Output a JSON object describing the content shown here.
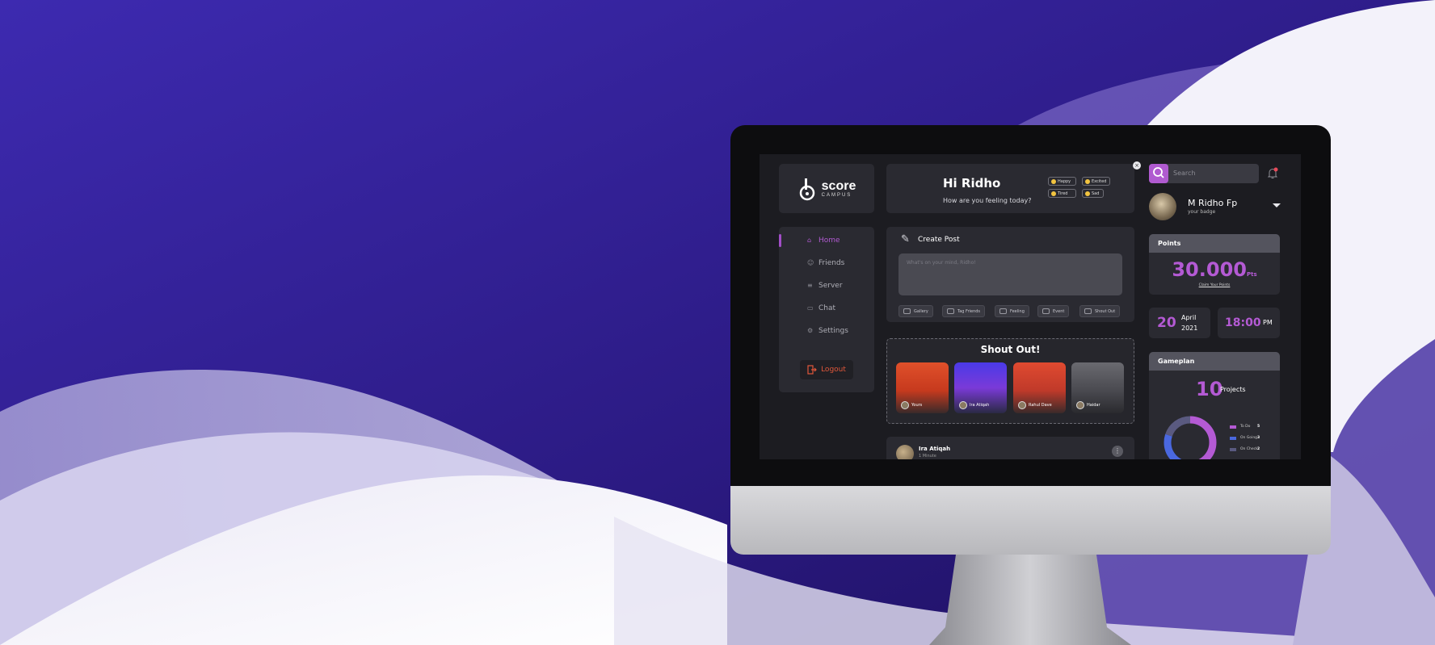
{
  "colors": {
    "background_top": "#2a1a7c",
    "accent": "#b45ad4",
    "logout": "#e0573a",
    "todo": "#b45ad4",
    "ongoing": "#4a68e0",
    "oncheck": "#5a5a80"
  },
  "logo": {
    "main": "score",
    "sub": "CAMPUS"
  },
  "nav": {
    "items": [
      {
        "label": "Home",
        "icon": "home-icon",
        "active": true
      },
      {
        "label": "Friends",
        "icon": "friends-icon",
        "active": false
      },
      {
        "label": "Server",
        "icon": "server-icon",
        "active": false
      },
      {
        "label": "Chat",
        "icon": "chat-icon",
        "active": false
      },
      {
        "label": "Settings",
        "icon": "settings-icon",
        "active": false
      }
    ],
    "logout": "Logout"
  },
  "greeting": {
    "title": "Hi  Ridho",
    "subtitle": "How are you feeling today?",
    "moods": [
      "Happy",
      "Excited",
      "Tired",
      "Sad"
    ]
  },
  "create_post": {
    "title": "Create Post",
    "placeholder": "What's on your mind, Ridho!",
    "actions": [
      "Gallery",
      "Tag Friends",
      "Feeling",
      "Event",
      "Shout Out"
    ]
  },
  "shout_out": {
    "title": "Shout Out!",
    "stories": [
      {
        "name": "Yours"
      },
      {
        "name": "Ira Atiqah"
      },
      {
        "name": "Rahul Dave"
      },
      {
        "name": "Haidar"
      }
    ]
  },
  "feed": {
    "name": "Ira Atiqah",
    "time": "1 Minute"
  },
  "search": {
    "placeholder": "Search"
  },
  "profile": {
    "name": "M Ridho Fp",
    "badge": "your badge"
  },
  "points": {
    "title": "Points",
    "value": "30.000",
    "unit": "Pts",
    "claim": "Claim Your Points"
  },
  "date": {
    "day": "20",
    "month": "April",
    "year": "2021"
  },
  "time": {
    "value": "18:00",
    "ampm": "PM"
  },
  "gameplan": {
    "title": "Gameplan",
    "count": "10",
    "count_label": "Projects",
    "legend": [
      {
        "label": "To Do",
        "value": 5
      },
      {
        "label": "On Going",
        "value": 3
      },
      {
        "label": "On Check",
        "value": 2
      }
    ]
  }
}
